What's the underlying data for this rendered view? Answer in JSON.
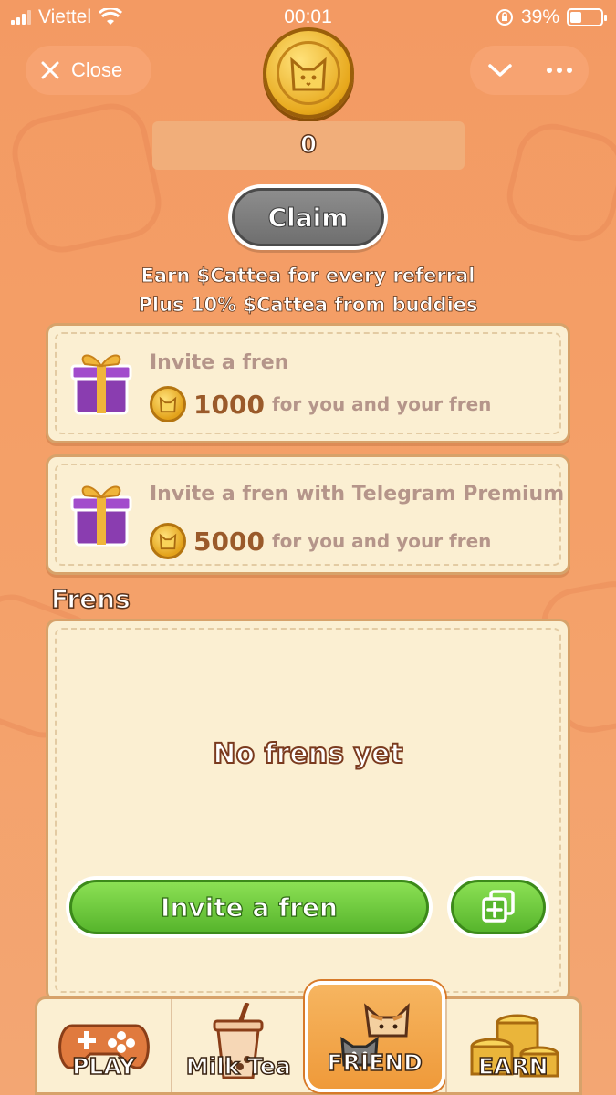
{
  "status_bar": {
    "carrier": "Viettel",
    "time": "00:01",
    "battery": "39%",
    "battery_level": 0.39
  },
  "top_bar": {
    "close_label": "Close",
    "chevron_icon": "chevron-down-icon",
    "more_icon": "more-dots-icon"
  },
  "balance": {
    "value": "0"
  },
  "claim": {
    "label": "Claim"
  },
  "info": {
    "line1": "Earn $Cattea for every referral",
    "line2": "Plus 10% $Cattea from buddies"
  },
  "rewards": [
    {
      "title": "Invite a fren",
      "amount": "1000",
      "desc": "for you and your fren"
    },
    {
      "title": "Invite a fren with Telegram Premium",
      "amount": "5000",
      "desc": "for you and your fren"
    }
  ],
  "frens": {
    "title": "Frens",
    "empty_text": "No frens yet",
    "invite_label": "Invite a fren"
  },
  "nav": [
    {
      "label": "PLAY",
      "icon": "gamepad-icon"
    },
    {
      "label": "Milk Tea",
      "icon": "milk-tea-icon"
    },
    {
      "label": "FRIEND",
      "icon": "cats-icon",
      "active": true
    },
    {
      "label": "EARN",
      "icon": "coin-stack-icon"
    }
  ],
  "colors": {
    "background": "#f39a63",
    "card": "#fbefd2",
    "green": "#57b52c",
    "gray_button": "#7a7a7a"
  }
}
